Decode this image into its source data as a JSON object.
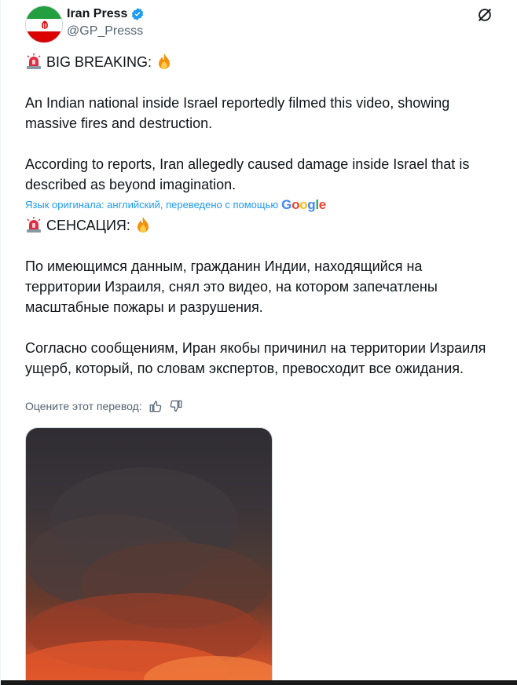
{
  "post": {
    "author": {
      "name": "Iran Press",
      "handle": "@GP_Presss",
      "verified": true
    },
    "original_heading": "BIG BREAKING:",
    "original_para1": "An Indian national inside Israel reportedly filmed this video, showing massive fires and destruction.",
    "original_para2": "According to reports, Iran allegedly caused damage inside Israel that is described as beyond imagination.",
    "translation_note": "Язык оригинала: английский, переведено с помощью",
    "translation_provider": "Google",
    "translated_heading": "СЕНСАЦИЯ:",
    "translated_para1": "По имеющимся данным, гражданин Индии, находящийся на территории Израиля, снял это видео, на котором запечатлены масштабные пожары и разрушения.",
    "translated_para2": "Согласно сообщениям, Иран якобы причинил на территории Израиля ущерб, который, по словам экспертов, превосходит все ожидания.",
    "rate_label": "Оцените этот перевод:"
  },
  "icons": {
    "siren": "siren-emoji-icon",
    "fire": "fire-emoji-icon",
    "grok": "grok-icon",
    "more": "more-icon",
    "thumbs_up": "thumbs-up-icon",
    "thumbs_down": "thumbs-down-icon",
    "verified": "verified-badge-icon"
  },
  "colors": {
    "accent": "#1d9bf0",
    "secondary_text": "#536471",
    "primary_text": "#0f1419"
  }
}
